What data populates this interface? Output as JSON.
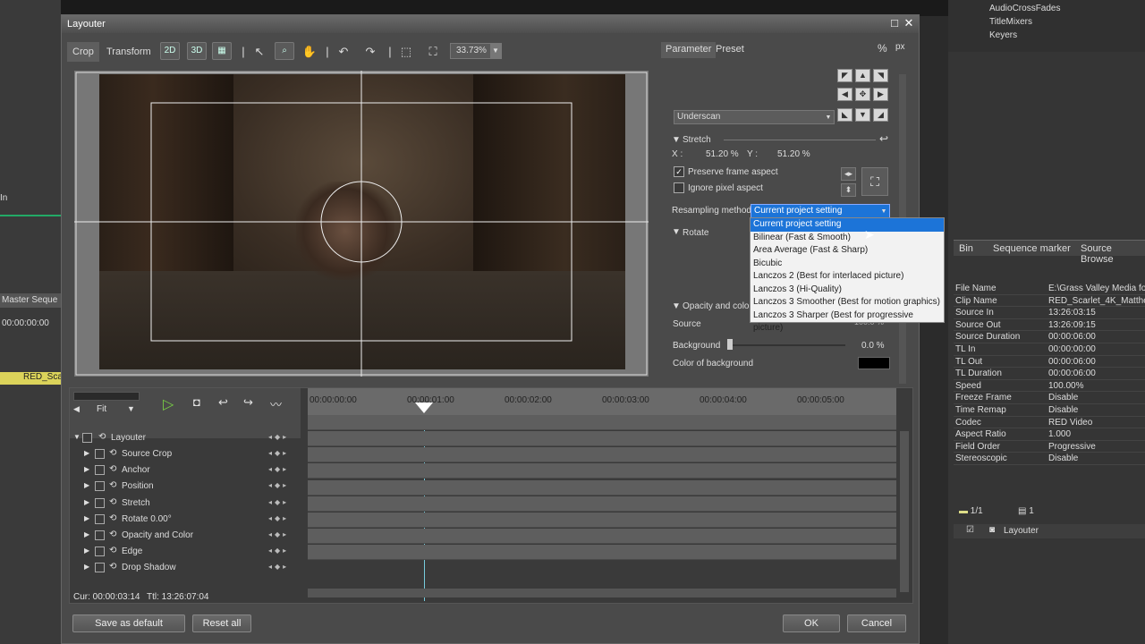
{
  "dialog": {
    "title": "Layouter",
    "maximize_icon": "maximize-icon",
    "close_icon": "close-icon"
  },
  "toolbar": {
    "tab_crop": "Crop",
    "tab_transform": "Transform",
    "zoom": "33.73%"
  },
  "panel": {
    "tab_parameter": "Parameter",
    "tab_preset": "Preset",
    "unit_percent": "%",
    "unit_px": "px",
    "underscan": "Underscan",
    "stretch_label": "Stretch",
    "stretch_x_label": "X :",
    "stretch_x": "51.20 %",
    "stretch_y_label": "Y :",
    "stretch_y": "51.20 %",
    "preserve_frame_aspect": "Preserve frame aspect",
    "ignore_pixel_aspect": "Ignore pixel aspect",
    "resampling_label": "Resampling method",
    "resampling_value": "Current project setting",
    "rotate_label": "Rotate",
    "opacity_label": "Opacity and color",
    "source_label": "Source",
    "source_value": "100.0 %",
    "background_label": "Background",
    "background_value": "0.0 %",
    "color_bg_label": "Color of background"
  },
  "resampling_options": [
    "Current project setting",
    "Bilinear (Fast & Smooth)",
    "Area Average (Fast & Sharp)",
    "Bicubic",
    "Lanczos 2 (Best for interlaced picture)",
    "Lanczos 3 (Hi-Quality)",
    "Lanczos 3 Smoother (Best for motion graphics)",
    "Lanczos 3 Sharper (Best for progressive picture)"
  ],
  "timeline": {
    "fit": "Fit",
    "ticks": [
      "00:00:00:00",
      "00:00:01:00",
      "00:00:02:00",
      "00:00:03:00",
      "00:00:04:00",
      "00:00:05:00"
    ],
    "root": "Layouter",
    "tracks": [
      {
        "name": "Source Crop"
      },
      {
        "name": "Anchor"
      },
      {
        "name": "Position"
      },
      {
        "name": "Stretch"
      },
      {
        "name": "Rotate   0.00°"
      },
      {
        "name": "Opacity and Color"
      },
      {
        "name": "Edge"
      },
      {
        "name": "Drop Shadow"
      }
    ],
    "cur": "Cur: 00:00:03:14",
    "ttl": "Ttl: 13:26:07:04"
  },
  "buttons": {
    "save_default": "Save as default",
    "reset_all": "Reset all",
    "ok": "OK",
    "cancel": "Cancel"
  },
  "right": {
    "tree": [
      "AudioCrossFades",
      "TitleMixers",
      "Keyers"
    ],
    "tabs": [
      "Bin",
      "Sequence marker",
      "Source Browse"
    ],
    "props": [
      {
        "k": "File Name",
        "v": "E:\\Grass Valley Media for"
      },
      {
        "k": "Clip Name",
        "v": "RED_Scarlet_4K_Matthe"
      },
      {
        "k": "Source In",
        "v": "13:26:03:15"
      },
      {
        "k": "Source Out",
        "v": "13:26:09:15"
      },
      {
        "k": "Source Duration",
        "v": "00:00:06:00"
      },
      {
        "k": "TL In",
        "v": "00:00:00:00"
      },
      {
        "k": "TL Out",
        "v": "00:00:06:00"
      },
      {
        "k": "TL Duration",
        "v": "00:00:06:00"
      },
      {
        "k": "Speed",
        "v": "100.00%"
      },
      {
        "k": "Freeze Frame",
        "v": "Disable"
      },
      {
        "k": "Time Remap",
        "v": "Disable"
      },
      {
        "k": "Codec",
        "v": "RED Video"
      },
      {
        "k": "Aspect Ratio",
        "v": "1.000"
      },
      {
        "k": "Field Order",
        "v": "Progressive"
      },
      {
        "k": "Stereoscopic",
        "v": "Disable"
      }
    ],
    "page": "1/1",
    "count": "1",
    "effect": "Layouter"
  },
  "left": {
    "label_in": "In",
    "master": "Master Seque",
    "tc": "00:00:00:00",
    "clip": "RED_Sca"
  }
}
